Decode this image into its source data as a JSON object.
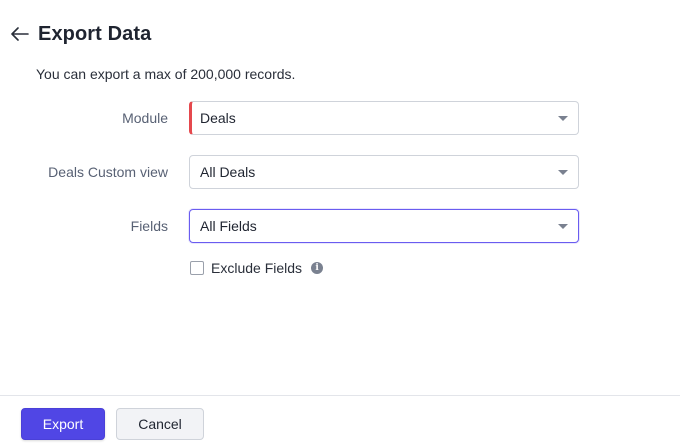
{
  "header": {
    "title": "Export Data",
    "back_icon": "arrow-left-icon"
  },
  "subtitle": "You can export a max of 200,000 records.",
  "form": {
    "module": {
      "label": "Module",
      "value": "Deals",
      "mandatory": true
    },
    "custom_view": {
      "label": "Deals Custom view",
      "value": "All Deals"
    },
    "fields": {
      "label": "Fields",
      "value": "All Fields"
    },
    "exclude_fields": {
      "label": "Exclude Fields",
      "checked": false,
      "info_icon": "info-icon"
    }
  },
  "footer": {
    "export_label": "Export",
    "cancel_label": "Cancel"
  },
  "colors": {
    "primary": "#5046e5",
    "mandatory_marker": "#e5484d",
    "focus_border": "#6a5cf0"
  }
}
